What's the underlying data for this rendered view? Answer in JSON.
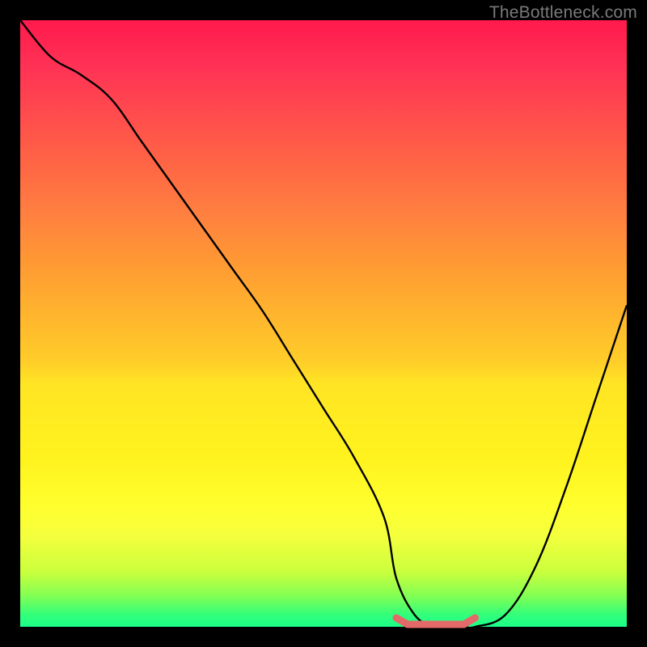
{
  "watermark": "TheBottleneck.com",
  "chart_data": {
    "type": "line",
    "title": "",
    "xlabel": "",
    "ylabel": "",
    "xlim": [
      0,
      100
    ],
    "ylim": [
      0,
      100
    ],
    "x": [
      0,
      5,
      10,
      15,
      20,
      25,
      30,
      35,
      40,
      45,
      50,
      55,
      60,
      62,
      65,
      68,
      70,
      73,
      75,
      80,
      85,
      90,
      95,
      100
    ],
    "values": [
      100,
      94,
      91,
      87,
      80,
      73,
      66,
      59,
      52,
      44,
      36,
      28,
      18,
      8,
      2,
      0,
      0,
      0,
      0,
      2,
      10,
      23,
      38,
      53
    ],
    "flat_segment_x": [
      62,
      75
    ],
    "annotations": [],
    "legend": null,
    "grid": false
  }
}
